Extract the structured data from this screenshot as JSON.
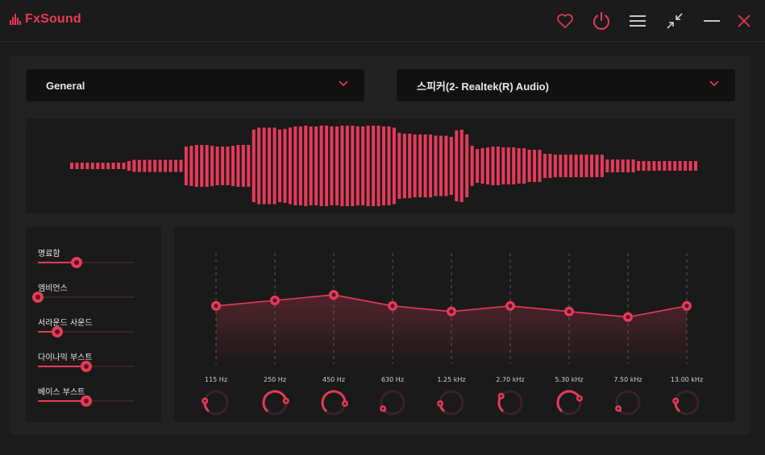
{
  "app": {
    "brand": "FxSound"
  },
  "titlebar": {
    "icons": [
      "heart-icon",
      "power-icon",
      "menu-icon",
      "minimize-view-icon",
      "minimize-icon",
      "close-icon"
    ],
    "accent": "#e63a5a"
  },
  "preset": {
    "selected": "General"
  },
  "output": {
    "selected": "스피커(2- Realtek(R) Audio)"
  },
  "visualizer": {
    "levels": [
      0.08,
      0.08,
      0.08,
      0.08,
      0.08,
      0.08,
      0.08,
      0.08,
      0.08,
      0.08,
      0.08,
      0.12,
      0.15,
      0.15,
      0.15,
      0.15,
      0.15,
      0.15,
      0.15,
      0.15,
      0.15,
      0.15,
      0.48,
      0.5,
      0.52,
      0.52,
      0.52,
      0.5,
      0.48,
      0.48,
      0.48,
      0.5,
      0.52,
      0.52,
      0.52,
      0.9,
      0.95,
      0.95,
      0.95,
      0.95,
      0.9,
      0.92,
      0.95,
      0.98,
      0.98,
      1.0,
      0.98,
      0.98,
      1.0,
      1.0,
      0.98,
      0.98,
      1.0,
      1.0,
      1.0,
      0.98,
      0.98,
      1.0,
      1.0,
      1.0,
      0.98,
      0.98,
      0.95,
      0.82,
      0.8,
      0.8,
      0.78,
      0.78,
      0.78,
      0.78,
      0.75,
      0.75,
      0.75,
      0.72,
      0.88,
      0.9,
      0.78,
      0.5,
      0.42,
      0.44,
      0.46,
      0.48,
      0.48,
      0.46,
      0.46,
      0.46,
      0.44,
      0.44,
      0.4,
      0.4,
      0.4,
      0.3,
      0.3,
      0.28,
      0.28,
      0.28,
      0.28,
      0.28,
      0.28,
      0.28,
      0.28,
      0.28,
      0.28,
      0.16,
      0.16,
      0.16,
      0.16,
      0.16,
      0.16,
      0.12,
      0.12,
      0.12,
      0.12,
      0.12,
      0.12,
      0.12,
      0.12,
      0.12,
      0.12,
      0.12,
      0.12
    ]
  },
  "effects": [
    {
      "label": "명료함",
      "value": 0.4
    },
    {
      "label": "엠비언스",
      "value": 0.0
    },
    {
      "label": "서라운드 사운드",
      "value": 0.2
    },
    {
      "label": "다이나믹 부스트",
      "value": 0.5
    },
    {
      "label": "베이스 부스트",
      "value": 0.5
    }
  ],
  "equalizer": {
    "bands": [
      {
        "freq": "115 Hz",
        "gain": 0.45
      },
      {
        "freq": "250 Hz",
        "gain": 0.5
      },
      {
        "freq": "450 Hz",
        "gain": 0.55
      },
      {
        "freq": "630 Hz",
        "gain": 0.45
      },
      {
        "freq": "1.25 kHz",
        "gain": 0.4
      },
      {
        "freq": "2.70 kHz",
        "gain": 0.45
      },
      {
        "freq": "5.30 kHz",
        "gain": 0.4
      },
      {
        "freq": "7.50 kHz",
        "gain": 0.35
      },
      {
        "freq": "13.00 kHz",
        "gain": 0.45
      }
    ],
    "knobs": [
      0.2,
      0.8,
      0.85,
      0.05,
      0.15,
      0.3,
      0.75,
      0.05,
      0.2
    ]
  }
}
